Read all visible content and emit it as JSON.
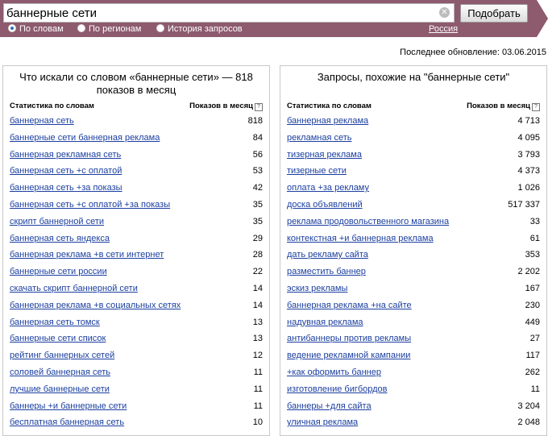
{
  "search": {
    "value": "баннерные сети",
    "button_label": "Подобрать"
  },
  "modes": [
    {
      "label": "По словам",
      "selected": true
    },
    {
      "label": "По регионам",
      "selected": false
    },
    {
      "label": "История запросов",
      "selected": false
    }
  ],
  "region_label": "Россия",
  "updated": "Последнее обновление: 03.06.2015",
  "left": {
    "title": "Что искали со словом «баннерные сети» — 818 показов в месяц",
    "col1": "Статистика по словам",
    "col2": "Показов в месяц",
    "rows": [
      {
        "q": "баннерная сеть",
        "n": "818"
      },
      {
        "q": "баннерные сети баннерная реклама",
        "n": "84"
      },
      {
        "q": "баннерная рекламная сеть",
        "n": "56"
      },
      {
        "q": "баннерная сеть +с оплатой",
        "n": "53"
      },
      {
        "q": "баннерная сеть +за показы",
        "n": "42"
      },
      {
        "q": "баннерная сеть +с оплатой +за показы",
        "n": "35"
      },
      {
        "q": "скрипт баннерной сети",
        "n": "35"
      },
      {
        "q": "баннерная сеть яндекса",
        "n": "29"
      },
      {
        "q": "баннерная реклама +в сети интернет",
        "n": "28"
      },
      {
        "q": "баннерные сети россии",
        "n": "22"
      },
      {
        "q": "скачать скрипт баннерной сети",
        "n": "14"
      },
      {
        "q": "баннерная реклама +в социальных сетях",
        "n": "14"
      },
      {
        "q": "баннерная сеть томск",
        "n": "13"
      },
      {
        "q": "баннерные сети список",
        "n": "13"
      },
      {
        "q": "рейтинг баннерных сетей",
        "n": "12"
      },
      {
        "q": "соловей баннерная сеть",
        "n": "11"
      },
      {
        "q": "лучшие баннерные сети",
        "n": "11"
      },
      {
        "q": "баннеры +и баннерные сети",
        "n": "11"
      },
      {
        "q": "бесплатная баннерная сеть",
        "n": "10"
      }
    ]
  },
  "right": {
    "title": "Запросы, похожие на \"баннерные сети\"",
    "col1": "Статистика по словам",
    "col2": "Показов в месяц",
    "rows": [
      {
        "q": "баннерная реклама",
        "n": "4 713"
      },
      {
        "q": "рекламная сеть",
        "n": "4 095"
      },
      {
        "q": "тизерная реклама",
        "n": "3 793"
      },
      {
        "q": "тизерные сети",
        "n": "4 373"
      },
      {
        "q": "оплата +за рекламу",
        "n": "1 026"
      },
      {
        "q": "доска объявлений",
        "n": "517 337"
      },
      {
        "q": "реклама продовольственного магазина",
        "n": "33"
      },
      {
        "q": "контекстная +и баннерная реклама",
        "n": "61"
      },
      {
        "q": "дать рекламу сайта",
        "n": "353"
      },
      {
        "q": "разместить баннер",
        "n": "2 202"
      },
      {
        "q": "эскиз рекламы",
        "n": "167"
      },
      {
        "q": "баннерная реклама +на сайте",
        "n": "230"
      },
      {
        "q": "надувная реклама",
        "n": "449"
      },
      {
        "q": "антибаннеры против рекламы",
        "n": "27"
      },
      {
        "q": "ведение рекламной кампании",
        "n": "117"
      },
      {
        "q": "+как оформить баннер",
        "n": "262"
      },
      {
        "q": "изготовление бигбордов",
        "n": "11"
      },
      {
        "q": "баннеры +для сайта",
        "n": "3 204"
      },
      {
        "q": "уличная реклама",
        "n": "2 048"
      }
    ]
  }
}
